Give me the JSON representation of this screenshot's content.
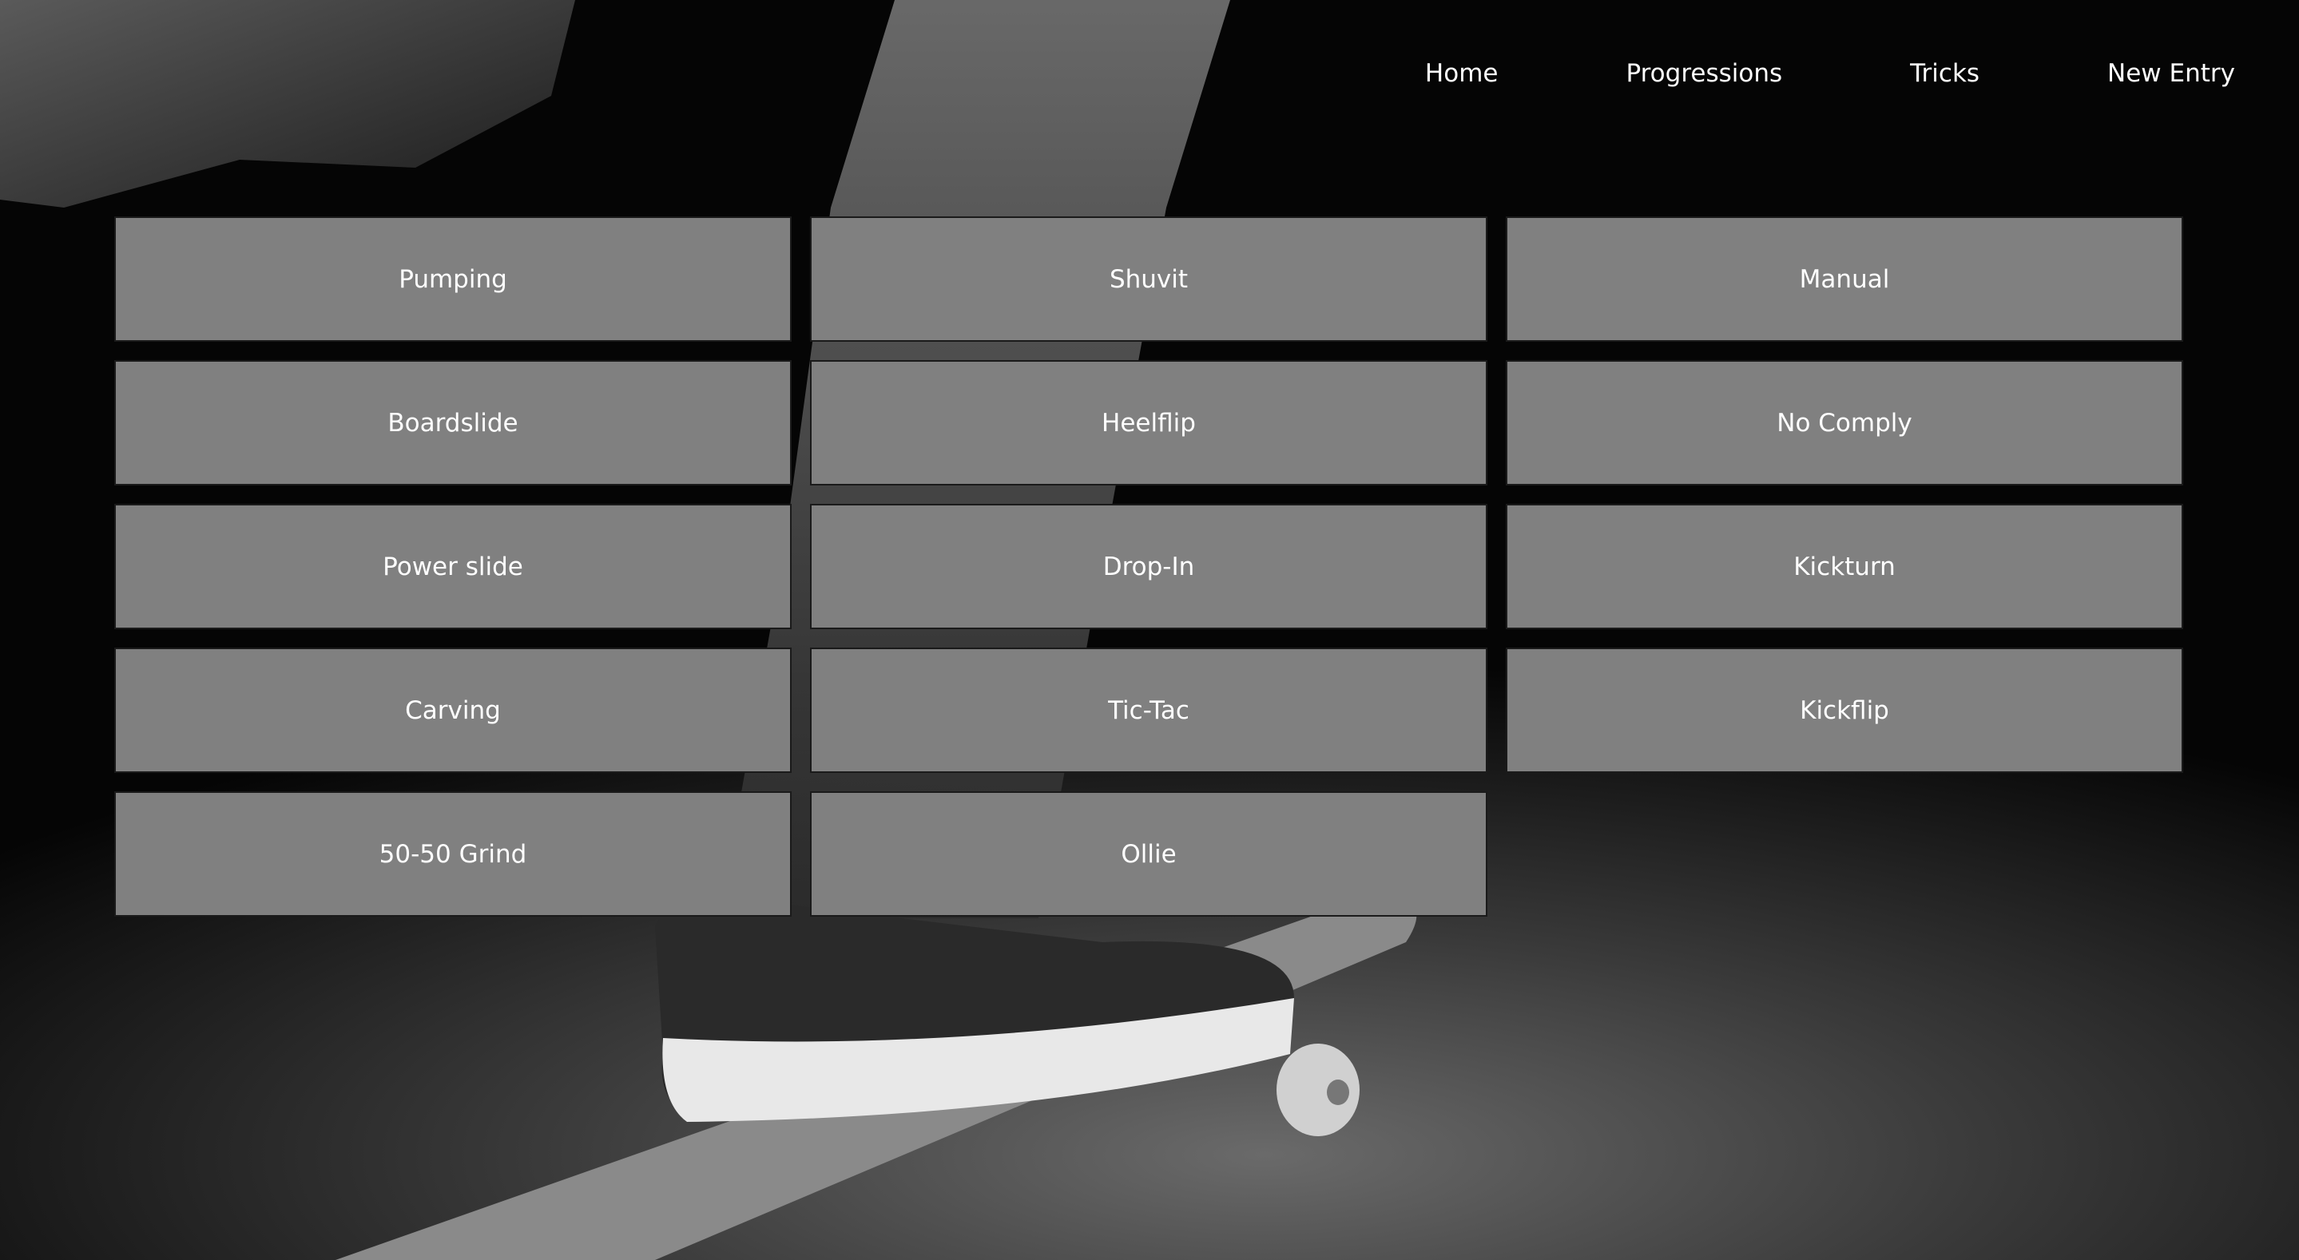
{
  "nav": {
    "items": [
      {
        "label": "Home"
      },
      {
        "label": "Progressions"
      },
      {
        "label": "Tricks"
      },
      {
        "label": "New Entry"
      }
    ]
  },
  "tricks": [
    {
      "label": "Pumping"
    },
    {
      "label": "Shuvit"
    },
    {
      "label": "Manual"
    },
    {
      "label": "Boardslide"
    },
    {
      "label": "Heelflip"
    },
    {
      "label": "No Comply"
    },
    {
      "label": "Power slide"
    },
    {
      "label": "Drop-In"
    },
    {
      "label": "Kickturn"
    },
    {
      "label": "Carving"
    },
    {
      "label": "Tic-Tac"
    },
    {
      "label": "Kickflip"
    },
    {
      "label": "50-50 Grind"
    },
    {
      "label": "Ollie"
    }
  ],
  "colors": {
    "tile_background": "#808080",
    "text": "#ffffff",
    "page_background": "#000000"
  }
}
